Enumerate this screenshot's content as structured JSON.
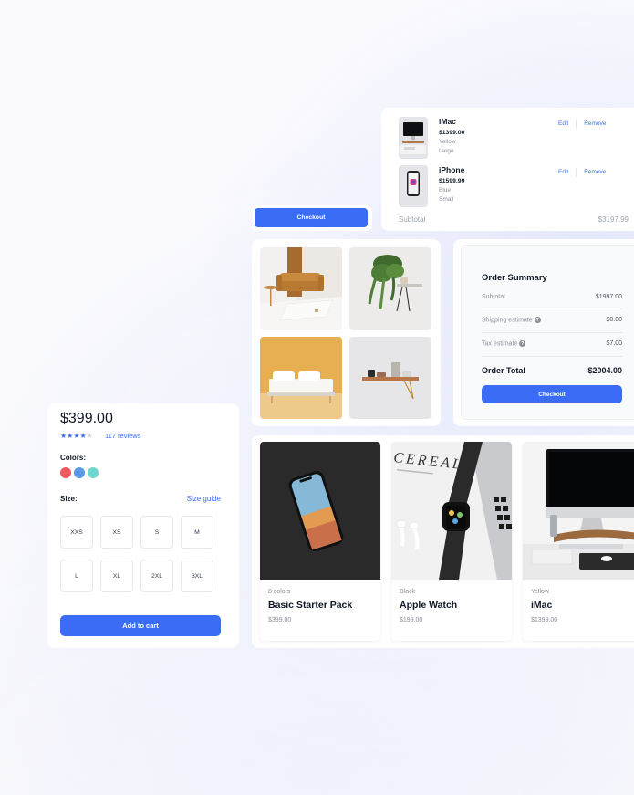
{
  "cart": {
    "items": [
      {
        "name": "iMac",
        "price": "$1399.00",
        "color": "Yellow",
        "size": "Large",
        "edit": "Edit",
        "remove": "Remove",
        "thumb_icon": "imac-thumbnail"
      },
      {
        "name": "iPhone",
        "price": "$1599.99",
        "color": "Blue",
        "size": "Small",
        "edit": "Edit",
        "remove": "Remove",
        "thumb_icon": "iphone-thumbnail"
      }
    ],
    "subtotal_label": "Subtotal",
    "subtotal_value": "$3197.99"
  },
  "checkout_small": {
    "label": "Checkout"
  },
  "gallery": {
    "images": [
      "sofa-room-image",
      "hanging-plant-image",
      "bed-image",
      "wall-shelf-image"
    ]
  },
  "summary": {
    "title": "Order Summary",
    "rows": [
      {
        "label": "Subtotal",
        "value": "$1997.00"
      },
      {
        "label": "Shipping estimate",
        "value": "$0.00"
      },
      {
        "label": "Tax estimate",
        "value": "$7.00"
      }
    ],
    "total_label": "Order Total",
    "total_value": "$2004.00",
    "checkout_label": "Checkout"
  },
  "product": {
    "price": "$399.00",
    "rating": 4,
    "rating_max": 5,
    "reviews": "117 reviews",
    "colors_label": "Colors:",
    "colors": [
      "#f05a5f",
      "#5b9be6",
      "#6fd6cb"
    ],
    "size_label": "Size:",
    "size_guide": "Size guide",
    "sizes": [
      "XXS",
      "XS",
      "S",
      "M",
      "L",
      "XL",
      "2XL",
      "3XL"
    ],
    "add_to_cart": "Add to cart"
  },
  "products": [
    {
      "subtitle": "8 colors",
      "name": "Basic Starter Pack",
      "price": "$399.00",
      "image": "iphone-photo"
    },
    {
      "subtitle": "Black",
      "name": "Apple Watch",
      "price": "$199.00",
      "image": "apple-watch-photo",
      "image_text": "CEREAL"
    },
    {
      "subtitle": "Yellow",
      "name": "iMac",
      "price": "$1399.00",
      "image": "imac-photo"
    }
  ],
  "colors": {
    "accent": "#3b6cf6",
    "muted_text": "#8a8f99",
    "star_off": "#d1d5db"
  }
}
